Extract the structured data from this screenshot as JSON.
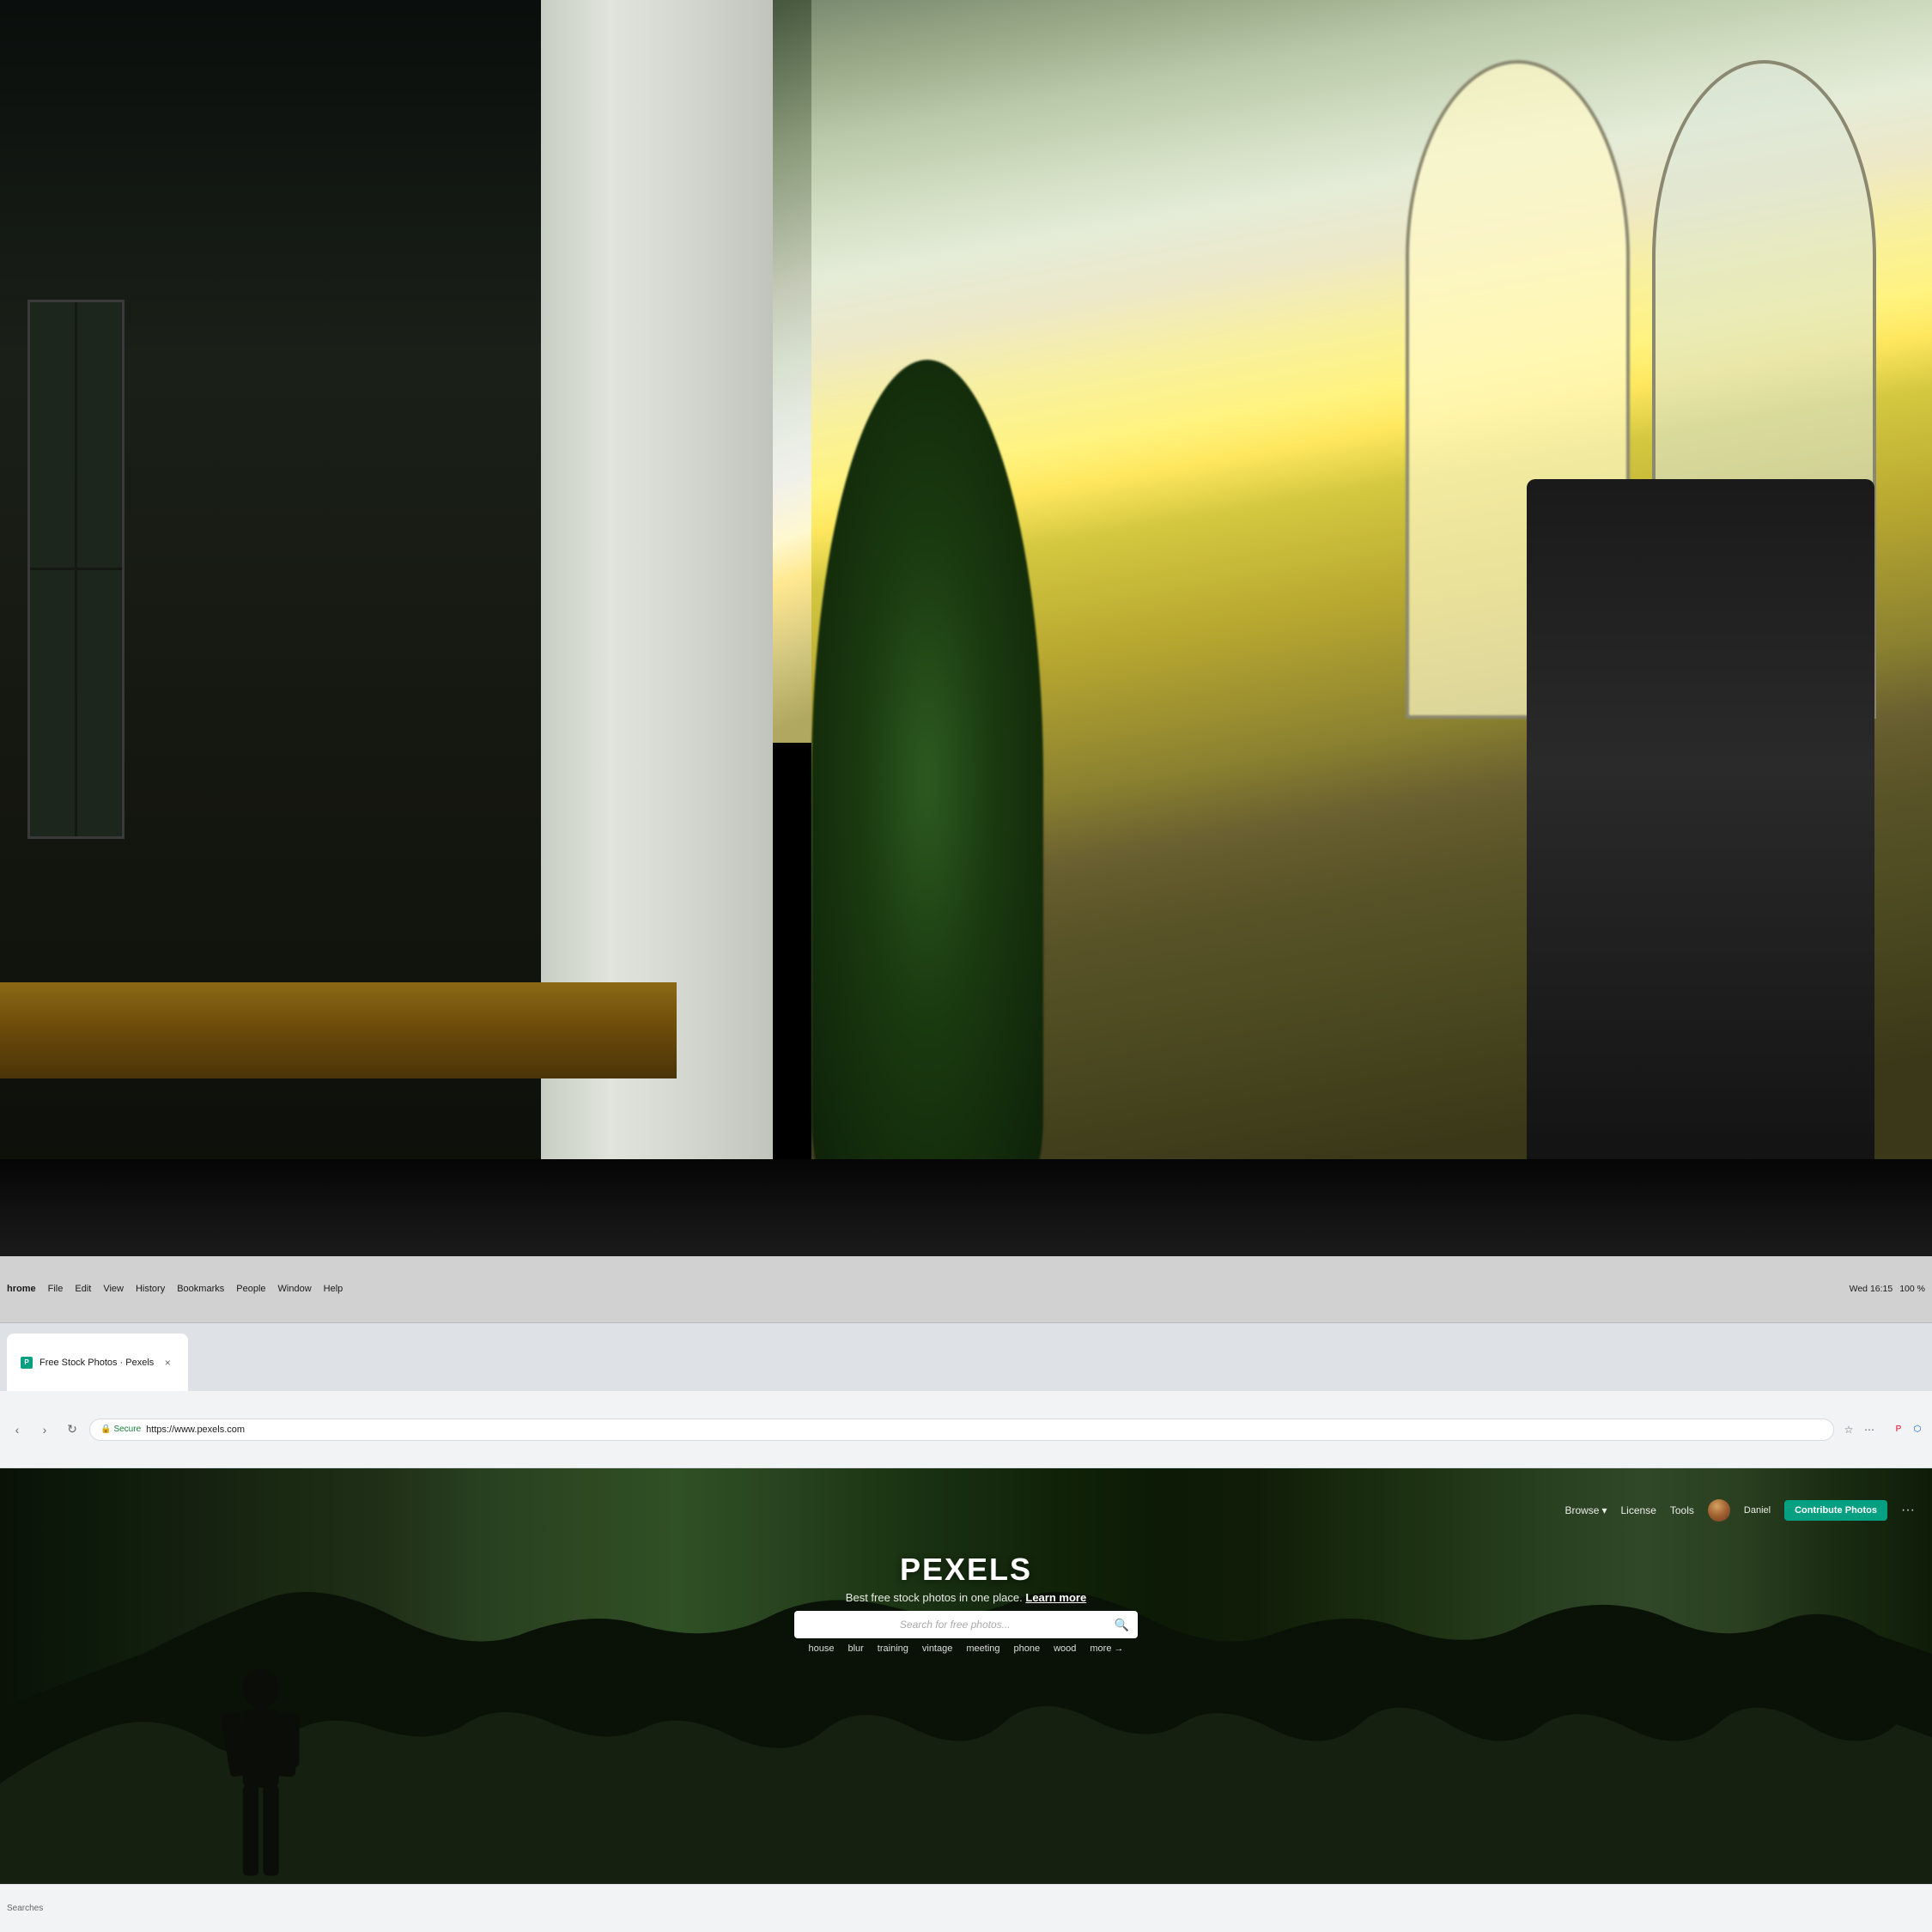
{
  "photo": {
    "alt": "Office scene with plant and windows"
  },
  "macos": {
    "menu_items": [
      "hrome",
      "File",
      "Edit",
      "View",
      "History",
      "Bookmarks",
      "People",
      "Window",
      "Help"
    ],
    "time": "Wed 16:15",
    "battery": "100 %"
  },
  "browser": {
    "tab_label": "Free Stock Photos · Pexels",
    "tab_close": "×",
    "secure_label": "Secure",
    "address": "https://www.pexels.com"
  },
  "pexels": {
    "nav": {
      "browse_label": "Browse",
      "license_label": "License",
      "tools_label": "Tools",
      "user_name": "Daniel",
      "contribute_label": "Contribute Photos",
      "more_label": "···"
    },
    "hero": {
      "title": "PEXELS",
      "subtitle": "Best free stock photos in one place.",
      "learn_more": "Learn more"
    },
    "search": {
      "placeholder": "Search for free photos...",
      "tags": [
        "house",
        "blur",
        "training",
        "vintage",
        "meeting",
        "phone",
        "wood"
      ],
      "more_label": "more →"
    }
  },
  "status_bar": {
    "text": "Searches"
  }
}
